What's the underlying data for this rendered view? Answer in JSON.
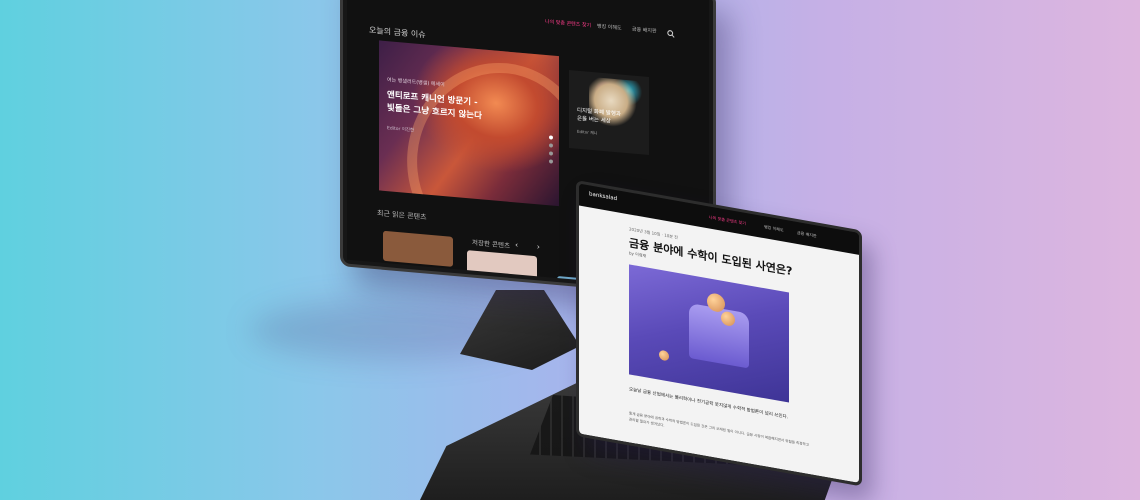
{
  "monitor": {
    "section_title": "오늘의 금융 이슈",
    "nav": [
      "나의 맞춤 콘텐츠 찾기",
      "뱅킹 이해도",
      "금융 배지판"
    ],
    "hero": {
      "kicker": "여는 뱅샐러드(뱅샐) 에세이",
      "title": "앤티로프 캐니언 방문기 -\n빛들은 그냥 흐르지 않는다",
      "author": "Editor 이진한"
    },
    "side_card": {
      "title": "디지털 화폐 발행과\n은을 버는 세상",
      "author": "Editor 제니"
    },
    "recent_label": "최근 읽은 콘텐츠",
    "saved_label": "저장한 콘텐츠",
    "arrows": "‹ ›",
    "search_icon": "search-icon"
  },
  "laptop": {
    "logo": "banksalad",
    "nav": [
      "나의 맞춤 콘텐츠 찾기",
      "뱅킹 이해도",
      "금융 배지판"
    ],
    "date": "2020년 3월 10일 · 10분 전",
    "title": "금융 분야에 수학이 도입된 사연은?",
    "byline": "by 이정재",
    "body_lead": "오늘날 금융 산업에서는 물리학이나 전기공학 못지않게 수학적 방법론이 널리 쓰인다.",
    "body_text": "통계 금융 분야에 공학과 수학의 방법론이 도입된 것은 그리 오래된 일이 아니다. 금융 시장이 복잡해지면서 위험을 측정하고 관리할 필요가 생겨났다.",
    "accent_color": "#ff3d8b"
  }
}
